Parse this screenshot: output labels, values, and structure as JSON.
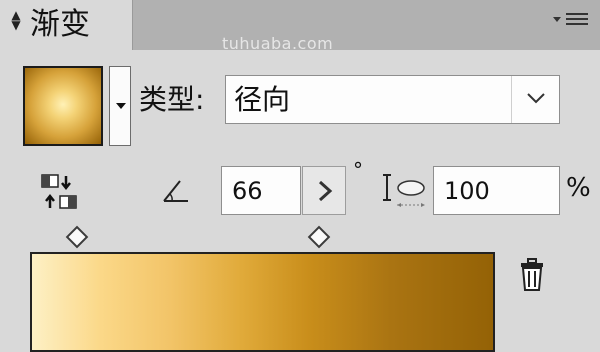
{
  "panel": {
    "tab_title": "渐变",
    "watermark": "tuhuaba.com",
    "menu_icon": "panel-menu-icon"
  },
  "swatch": {
    "gradient_colors": [
      "#fff1b6",
      "#f4d377",
      "#d6a23a",
      "#946106"
    ]
  },
  "type": {
    "label": "类型:",
    "value": "径向"
  },
  "angle": {
    "value": "66",
    "unit": "°"
  },
  "aspect": {
    "value": "100",
    "unit": "%"
  },
  "gradient_bar": {
    "colors": [
      "#fdf0c5",
      "#fbd888",
      "#e1ab3b",
      "#946206"
    ]
  }
}
